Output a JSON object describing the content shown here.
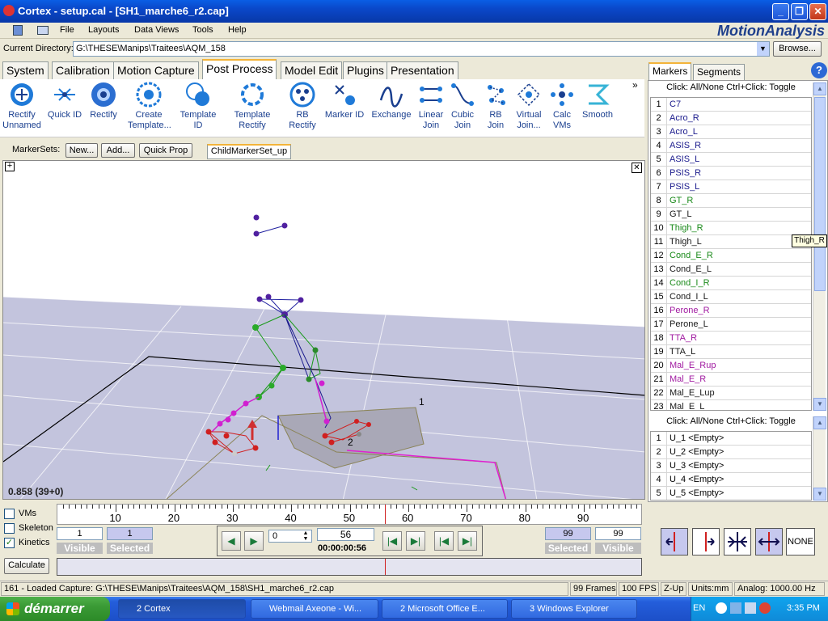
{
  "window": {
    "title": "Cortex  - setup.cal - [SH1_marche6_r2.cap]",
    "min": "_",
    "max": "❐",
    "close": "✕"
  },
  "menu": [
    "File",
    "Layouts",
    "Data Views",
    "Tools",
    "Help"
  ],
  "logo": "MotionAnalysis",
  "directory": {
    "label": "Current Directory:",
    "value": "G:\\THESE\\Manips\\Traitees\\AQM_158",
    "browse": "Browse..."
  },
  "tabs": [
    "System",
    "Calibration",
    "Motion Capture",
    "Post Process",
    "Model Edit",
    "Plugins",
    "Presentation"
  ],
  "tools": [
    {
      "l1": "Rectify",
      "l2": "Unnamed"
    },
    {
      "l1": "Quick ID",
      "l2": ""
    },
    {
      "l1": "Rectify",
      "l2": ""
    },
    {
      "l1": "Create",
      "l2": "Template..."
    },
    {
      "l1": "Template",
      "l2": "ID"
    },
    {
      "l1": "Template",
      "l2": "Rectify"
    },
    {
      "l1": "RB",
      "l2": "Rectify"
    },
    {
      "l1": "Marker ID",
      "l2": ""
    },
    {
      "l1": "Exchange",
      "l2": ""
    },
    {
      "l1": "Linear",
      "l2": "Join"
    },
    {
      "l1": "Cubic",
      "l2": "Join"
    },
    {
      "l1": "RB",
      "l2": "Join"
    },
    {
      "l1": "Virtual",
      "l2": "Join..."
    },
    {
      "l1": "Calc",
      "l2": "VMs"
    },
    {
      "l1": "Smooth",
      "l2": ""
    }
  ],
  "markersets": {
    "label": "MarkerSets:",
    "new": "New...",
    "add": "Add...",
    "quickprop": "Quick Prop",
    "active": "ChildMarkerSet_up"
  },
  "viewport": {
    "readout": "0.858 (39+0)",
    "plate1": "1",
    "plate2": "2"
  },
  "rightpanel": {
    "tabs": [
      "Markers",
      "Segments"
    ],
    "help": "?",
    "hint": "Click: All/None  Ctrl+Click: Toggle",
    "tooltip": "Thigh_R",
    "markers": [
      {
        "i": "1",
        "n": "C7",
        "c": "#1a1a8c"
      },
      {
        "i": "2",
        "n": "Acro_R",
        "c": "#1a1a8c"
      },
      {
        "i": "3",
        "n": "Acro_L",
        "c": "#1a1a8c"
      },
      {
        "i": "4",
        "n": "ASIS_R",
        "c": "#1a1a8c"
      },
      {
        "i": "5",
        "n": "ASIS_L",
        "c": "#1a1a8c"
      },
      {
        "i": "6",
        "n": "PSIS_R",
        "c": "#1a1a8c"
      },
      {
        "i": "7",
        "n": "PSIS_L",
        "c": "#1a1a8c"
      },
      {
        "i": "8",
        "n": "GT_R",
        "c": "#1a8a1a"
      },
      {
        "i": "9",
        "n": "GT_L",
        "c": "#1a1a1a"
      },
      {
        "i": "10",
        "n": "Thigh_R",
        "c": "#1a8a1a"
      },
      {
        "i": "11",
        "n": "Thigh_L",
        "c": "#1a1a1a"
      },
      {
        "i": "12",
        "n": "Cond_E_R",
        "c": "#1a8a1a"
      },
      {
        "i": "13",
        "n": "Cond_E_L",
        "c": "#1a1a1a"
      },
      {
        "i": "14",
        "n": "Cond_I_R",
        "c": "#1a8a1a"
      },
      {
        "i": "15",
        "n": "Cond_I_L",
        "c": "#1a1a1a"
      },
      {
        "i": "16",
        "n": "Perone_R",
        "c": "#a01aa0"
      },
      {
        "i": "17",
        "n": "Perone_L",
        "c": "#1a1a1a"
      },
      {
        "i": "18",
        "n": "TTA_R",
        "c": "#a01aa0"
      },
      {
        "i": "19",
        "n": "TTA_L",
        "c": "#1a1a1a"
      },
      {
        "i": "20",
        "n": "Mal_E_Rup",
        "c": "#a01aa0"
      },
      {
        "i": "21",
        "n": "Mal_E_R",
        "c": "#a01aa0"
      },
      {
        "i": "22",
        "n": "Mal_E_Lup",
        "c": "#1a1a1a"
      },
      {
        "i": "23",
        "n": "Mal_E_L",
        "c": "#1a1a1a"
      }
    ],
    "unnamed": [
      {
        "i": "1",
        "n": "U_1 <Empty>"
      },
      {
        "i": "2",
        "n": "U_2 <Empty>"
      },
      {
        "i": "3",
        "n": "U_3 <Empty>"
      },
      {
        "i": "4",
        "n": "U_4 <Empty>"
      },
      {
        "i": "5",
        "n": "U_5 <Empty>"
      }
    ],
    "none": "NONE"
  },
  "timeline": {
    "vms": "VMs",
    "skeleton": "Skeleton",
    "kinetics": "Kinetics",
    "ticks": [
      "10",
      "20",
      "30",
      "40",
      "50",
      "60",
      "70",
      "80",
      "90"
    ],
    "left_visible": "1",
    "left_selected": "1",
    "visible_label": "Visible",
    "selected_label": "Selected",
    "frame_spin": "0",
    "frame": "56",
    "time": "00:00:00:56",
    "right_selected": "99",
    "right_visible": "99",
    "calculate": "Calculate",
    "current_frame": 56,
    "frames_total": 99
  },
  "status": {
    "message": "161 - Loaded Capture: G:\\THESE\\Manips\\Traitees\\AQM_158\\SH1_marche6_r2.cap",
    "frames": "99 Frames",
    "fps": "100 FPS",
    "axis": "Z-Up",
    "units": "Units:mm",
    "analog": "Analog: 1000.00 Hz"
  },
  "taskbar": {
    "start": "démarrer",
    "tasks": [
      "2 Cortex",
      "Webmail Axeone - Wi...",
      "2 Microsoft Office E...",
      "3 Windows Explorer"
    ],
    "lang": "EN",
    "clock": "3:35 PM"
  }
}
